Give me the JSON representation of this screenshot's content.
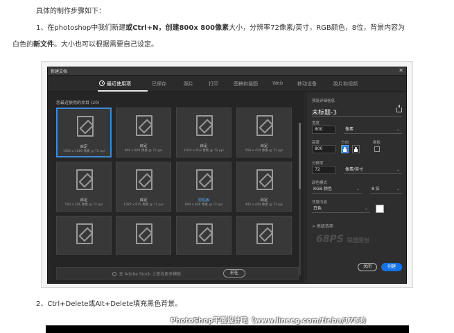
{
  "article": {
    "intro": "具体的制作步骤如下：",
    "step1_a": "1、在photoshop中我们新建",
    "step1_b": "或Ctrl+N，创建800x 800像素",
    "step1_c": "大小，分辨率72像素/英寸，RGB颜色，8位，背景内容为",
    "step1_d": "白色的",
    "step1_e": "新文件",
    "step1_f": "。大小也可以根据需要自己设定。",
    "step2": "2、Ctrl+Delete或Alt+Delete填充黑色背景。"
  },
  "dialog": {
    "title": "新建文档",
    "close": "✕",
    "tabs": [
      "最近使用项",
      "已保存",
      "照片",
      "打印",
      "图稿和插图",
      "Web",
      "移动设备",
      "胶片和视频"
    ],
    "recent_label": "您最近使用的项目 (20)",
    "cards": [
      {
        "name": "自定",
        "spec": "1920 x 1080 像素 @ 72 ppi"
      },
      {
        "name": "自定",
        "spec": "800 x 800 像素 @ 72 ppi"
      },
      {
        "name": "自定",
        "spec": "1024 x 652 像素 @ 72 ppi"
      },
      {
        "name": "自定",
        "spec": "559 x 414 像素 @ 72 ppi"
      },
      {
        "name": "自定",
        "spec": "543 x 306 像素 @ 72 ppi"
      },
      {
        "name": "自定",
        "spec": "1287 x 635 像素 @ 72 ppi"
      },
      {
        "name": "剪贴板",
        "spec": "994 x 606 像素 @ 72 ppi"
      },
      {
        "name": "自定",
        "spec": "442 x 444 像素 @ 72 ppi"
      }
    ],
    "stock_search": "在 Adobe Stock 上查找更多模板",
    "go": "前往",
    "preset": {
      "section": "预设详细信息",
      "name": "未标题-3",
      "width_label": "宽度",
      "width": "800",
      "width_unit": "像素",
      "height_label": "高度",
      "height": "800",
      "orientation_label": "方向",
      "artboard_label": "画板",
      "resolution_label": "分辨率",
      "resolution": "72",
      "resolution_unit": "像素/英寸",
      "color_mode_label": "颜色模式",
      "color_mode": "RGB 颜色",
      "bit_depth": "8 位",
      "bg_label": "背景内容",
      "bg": "白色",
      "advanced": "> 高级选项",
      "close_btn": "关闭",
      "create_btn": "创建"
    },
    "logo_text": "68PS",
    "logo_sub": "联盟原创"
  },
  "watermark": "PhotoShop平面设计吧（www.lineeg.com/tieba/1783）",
  "colors": {
    "accent": "#1473e6",
    "selected_border": "#3d8bd9",
    "dialog_bg": "#2b2b2b"
  }
}
